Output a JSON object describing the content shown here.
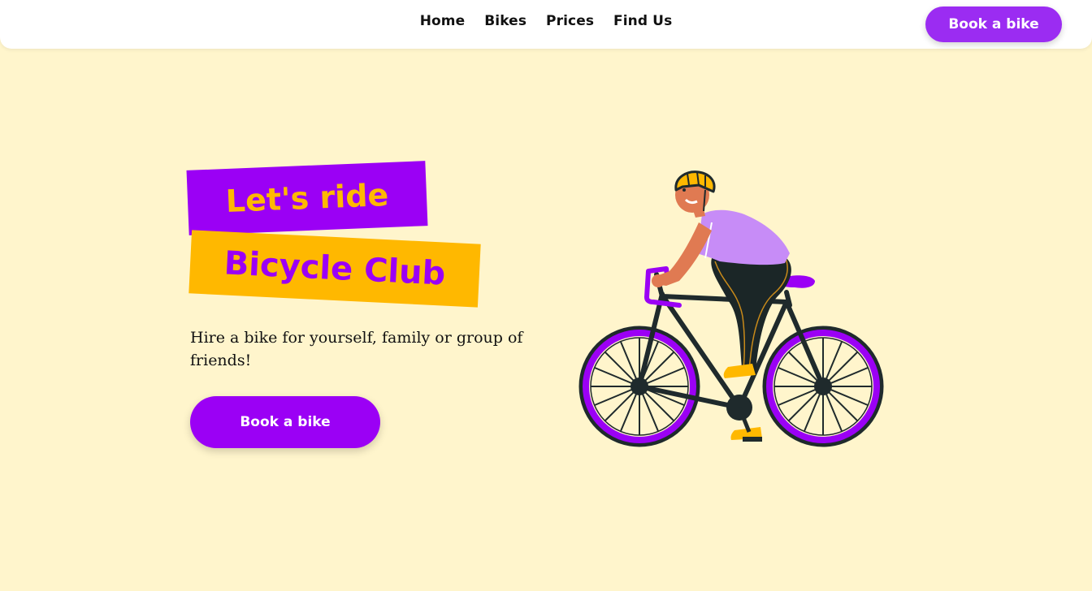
{
  "nav": {
    "items": [
      {
        "label": "Home"
      },
      {
        "label": "Bikes"
      },
      {
        "label": "Prices"
      },
      {
        "label": "Find Us"
      }
    ],
    "cta_label": "Book a bike"
  },
  "hero": {
    "tagline_1": "Let's ride",
    "tagline_2": "Bicycle Club",
    "description": "Hire a bike for yourself, family or group of friends!",
    "cta_label": "Book a bike"
  },
  "colors": {
    "accent_purple": "#9b00f5",
    "accent_yellow": "#ffb800",
    "background": "#fff5cc"
  },
  "illustration": {
    "icon": "cyclist-illustration"
  }
}
